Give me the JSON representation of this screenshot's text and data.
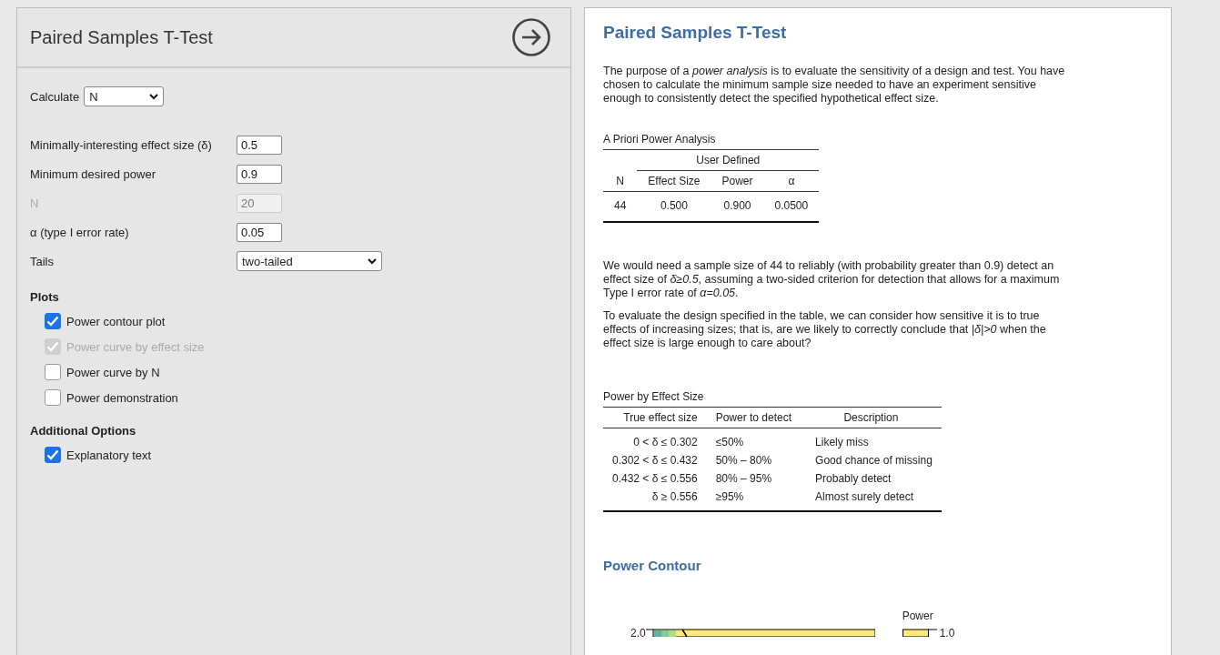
{
  "options_panel": {
    "title": "Paired Samples T-Test",
    "calculate": {
      "label": "Calculate",
      "value": "N"
    },
    "fields": [
      {
        "label": "Minimally-interesting effect size (δ)",
        "value": "0.5",
        "disabled": false
      },
      {
        "label": "Minimum desired power",
        "value": "0.9",
        "disabled": false
      },
      {
        "label": "N",
        "value": "20",
        "disabled": true
      },
      {
        "label": "α (type I error rate)",
        "value": "0.05",
        "disabled": false
      }
    ],
    "tails": {
      "label": "Tails",
      "value": "two-tailed"
    },
    "sections": [
      {
        "heading": "Plots",
        "options": [
          {
            "label": "Power contour plot",
            "checked": true,
            "disabled": false
          },
          {
            "label": "Power curve by effect size",
            "checked": true,
            "disabled": true
          },
          {
            "label": "Power curve by N",
            "checked": false,
            "disabled": false
          },
          {
            "label": "Power demonstration",
            "checked": false,
            "disabled": false
          }
        ]
      },
      {
        "heading": "Additional Options",
        "options": [
          {
            "label": "Explanatory text",
            "checked": true,
            "disabled": false
          }
        ]
      }
    ]
  },
  "results": {
    "title": "Paired Samples T-Test",
    "intro": "The purpose of a *power analysis* is to evaluate the sensitivity of a design and test. You have chosen to calculate the minimum sample size needed to have an experiment sensitive enough to consistently detect the specified hypothetical effect size.",
    "table1": {
      "title": "A Priori Power Analysis",
      "group_header": "User Defined",
      "columns": [
        "N",
        "Effect Size",
        "Power",
        "α"
      ],
      "rows": [
        [
          "44",
          "0.500",
          "0.900",
          "0.0500"
        ]
      ]
    },
    "paragraphs": [
      "We would need a sample size of 44 to reliably (with probability greater than 0.9) detect an effect size of *δ≥0.5*, assuming a two-sided criterion for detection that allows for a maximum Type I error rate of *α=0.05*.",
      "To evaluate the design specified in the table, we can consider how sensitive it is to true effects of increasing sizes; that is, are we likely to correctly conclude that *|δ|>0* when the effect size is large enough to care about?"
    ],
    "table2": {
      "title": "Power by Effect Size",
      "columns": [
        "True effect size",
        "Power to detect",
        "Description"
      ],
      "rows": [
        [
          "0 < δ ≤ 0.302",
          "≤50%",
          "Likely miss"
        ],
        [
          "0.302 < δ ≤ 0.432",
          "50% – 80%",
          "Good chance of missing"
        ],
        [
          "0.432 < δ ≤ 0.556",
          "80% – 95%",
          "Probably detect"
        ],
        [
          "δ ≥ 0.556",
          "≥95%",
          "Almost surely detect"
        ]
      ]
    },
    "contour": {
      "title": "Power Contour",
      "legend_title": "Power",
      "y_tick": "2.0",
      "legend_tick": "1.0"
    }
  }
}
